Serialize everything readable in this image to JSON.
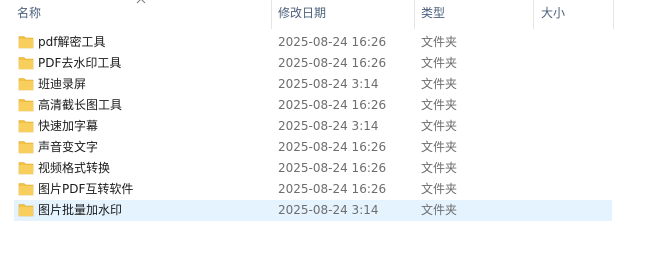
{
  "columns": {
    "name": "名称",
    "date": "修改日期",
    "type": "类型",
    "size": "大小"
  },
  "icons": {
    "folder": "folder-icon",
    "sort": "chevron-up-icon"
  },
  "colors": {
    "folder": "#f3c244",
    "selection": "#e5f3ff"
  },
  "files": [
    {
      "name": "pdf解密工具",
      "date": "2025-08-24 16:26",
      "type": "文件夹"
    },
    {
      "name": "PDF去水印工具",
      "date": "2025-08-24 16:26",
      "type": "文件夹"
    },
    {
      "name": "班迪录屏",
      "date": "2025-08-24 3:14",
      "type": "文件夹"
    },
    {
      "name": "高清截长图工具",
      "date": "2025-08-24 16:26",
      "type": "文件夹"
    },
    {
      "name": "快速加字幕",
      "date": "2025-08-24 3:14",
      "type": "文件夹"
    },
    {
      "name": "声音变文字",
      "date": "2025-08-24 16:26",
      "type": "文件夹"
    },
    {
      "name": "视频格式转换",
      "date": "2025-08-24 16:26",
      "type": "文件夹"
    },
    {
      "name": "图片PDF互转软件",
      "date": "2025-08-24 16:26",
      "type": "文件夹"
    },
    {
      "name": "图片批量加水印",
      "date": "2025-08-24 3:14",
      "type": "文件夹"
    }
  ]
}
